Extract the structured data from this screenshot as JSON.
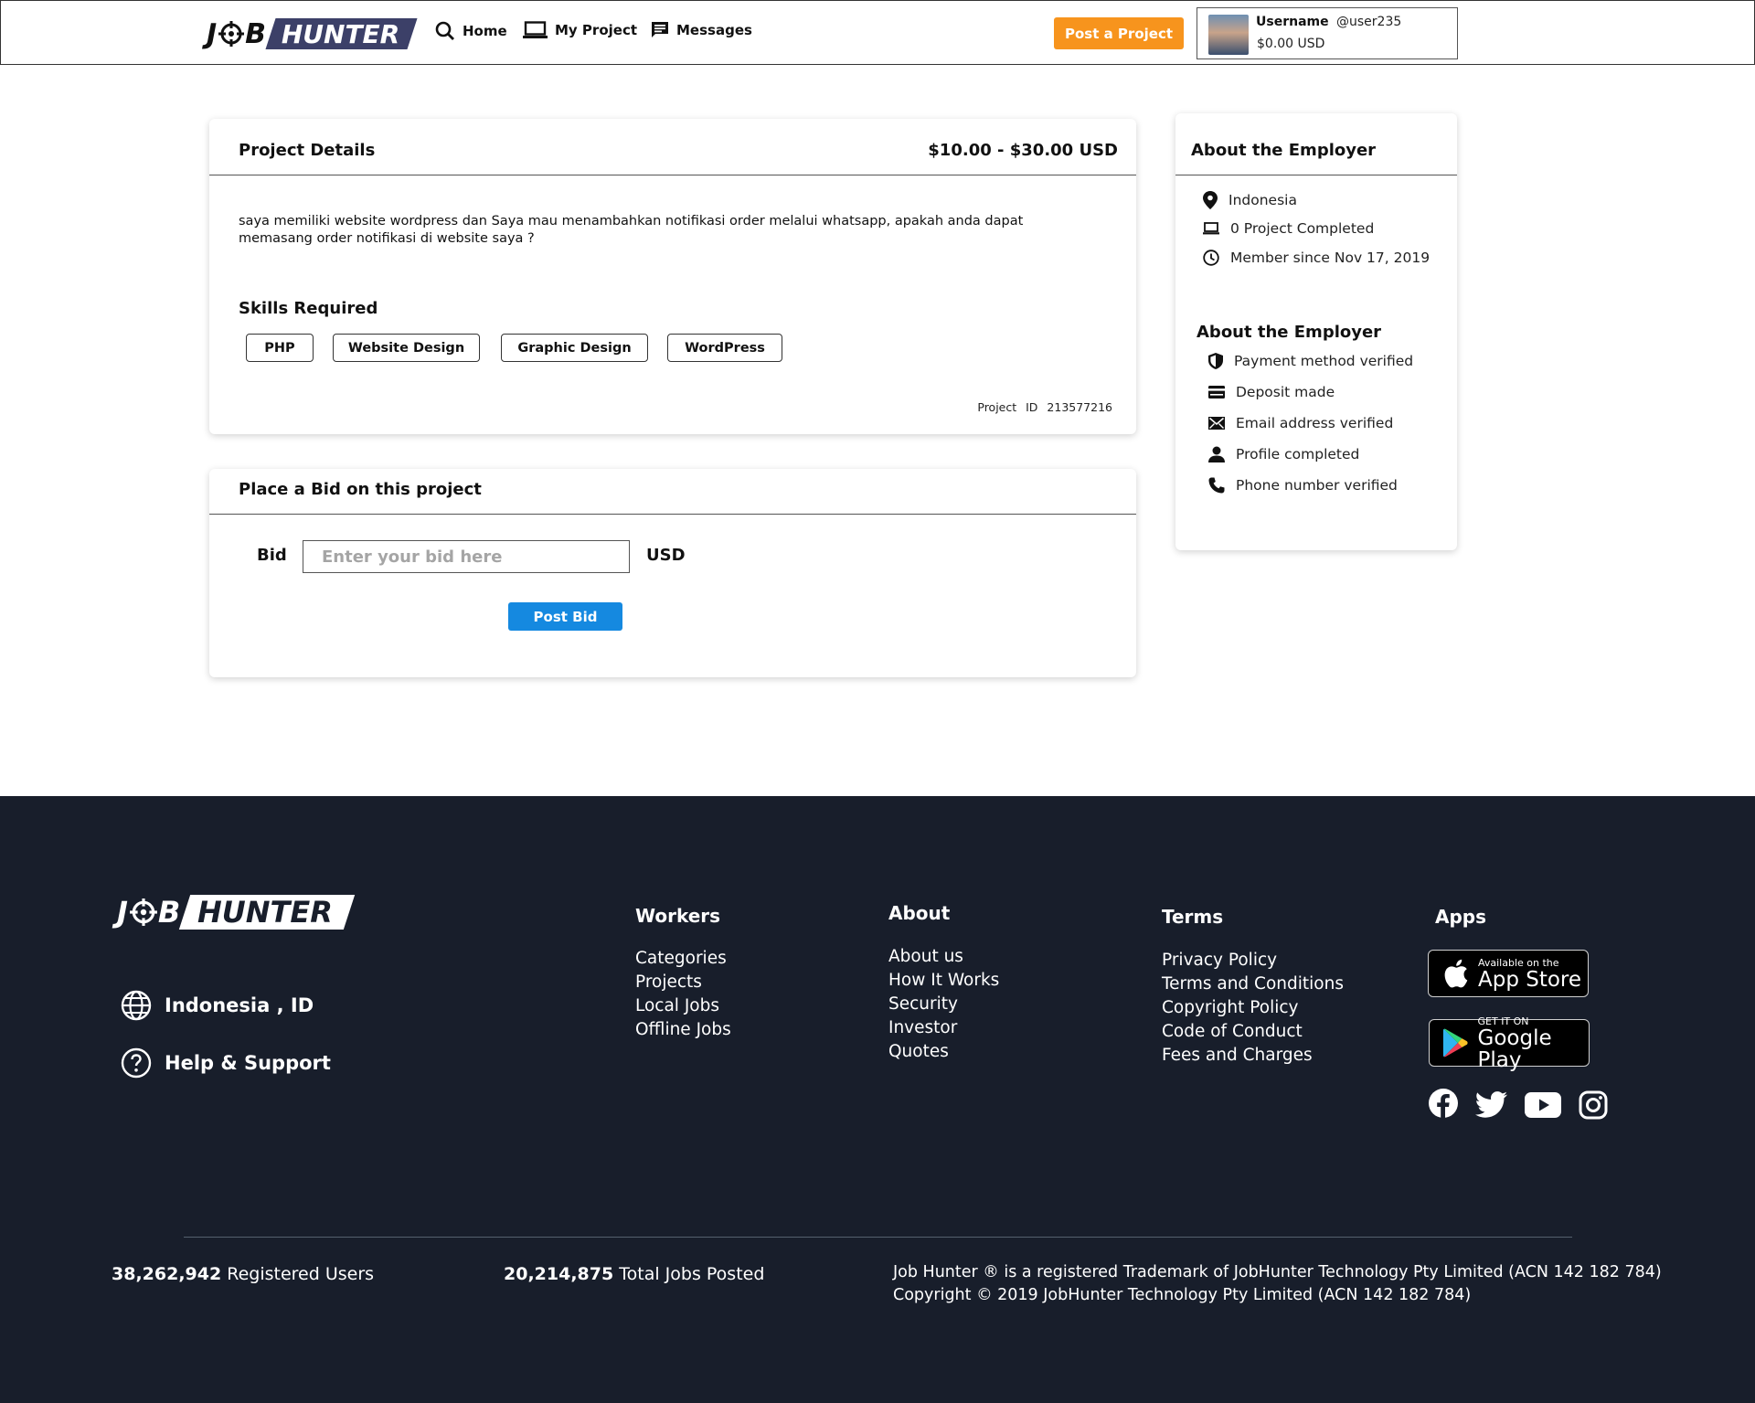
{
  "nav": {
    "logo_left": "J",
    "logo_right": "B",
    "logo_hunter": "HUNTER",
    "links": [
      "Home",
      "My Project",
      "Messages"
    ],
    "post_project": "Post a Project",
    "user": {
      "name": "Username",
      "handle": "@user235",
      "balance": "$0.00 USD"
    }
  },
  "project": {
    "title": "Project Details",
    "budget": "$10.00 - $30.00 USD",
    "description": "saya memiliki website wordpress dan Saya mau menambahkan notifikasi order melalui whatsapp, apakah anda dapat memasang order notifikasi di website saya ?",
    "skills_title": "Skills Required",
    "skills": [
      "PHP",
      "Website Design",
      "Graphic Design",
      "WordPress"
    ],
    "project_id_label": "Project ID",
    "project_id": "213577216"
  },
  "bid": {
    "title": "Place a Bid on this project",
    "label": "Bid",
    "placeholder": "Enter your bid here",
    "currency": "USD",
    "button": "Post Bid"
  },
  "employer": {
    "title": "About the Employer",
    "country": "Indonesia",
    "projects_completed": "0 Project Completed",
    "member_since": "Member since Nov 17, 2019",
    "verification_title": "About the Employer",
    "verifications": [
      "Payment method verified",
      "Deposit made",
      "Email address verified",
      "Profile completed",
      "Phone number verified"
    ]
  },
  "footer": {
    "logo_left": "J",
    "logo_right": "B",
    "logo_hunter": "HUNTER",
    "locale": "Indonesia , ID",
    "help": "Help & Support",
    "workers": {
      "title": "Workers",
      "links": [
        "Categories",
        "Projects",
        "Local Jobs",
        "Offline Jobs"
      ]
    },
    "about": {
      "title": "About",
      "links": [
        "About us",
        "How It Works",
        "Security",
        "Investor",
        "Quotes"
      ]
    },
    "terms": {
      "title": "Terms",
      "links": [
        "Privacy Policy",
        "Terms and Conditions",
        "Copyright Policy",
        "Code of Conduct",
        "Fees and Charges"
      ]
    },
    "apps": {
      "title": "Apps",
      "app_store_small": "Available on the",
      "app_store_big": "App Store",
      "google_small": "GET IT ON",
      "google_big": "Google Play"
    },
    "social_icons": [
      "facebook-icon",
      "twitter-icon",
      "youtube-icon",
      "instagram-icon"
    ],
    "stats": {
      "users_count": "38,262,942",
      "users_label": "Registered Users",
      "jobs_count": "20,214,875",
      "jobs_label": "Total Jobs Posted"
    },
    "trademark": "Job Hunter ® is a registered Trademark of JobHunter Technology Pty Limited (ACN 142 182 784)",
    "copyright": "Copyright © 2019 JobHunter Technology Pty Limited (ACN 142 182 784)"
  },
  "colors": {
    "accent_orange": "#f7941d",
    "accent_blue": "#1589e0",
    "logo_navy": "#3c4068",
    "footer_bg": "#181e2b"
  }
}
